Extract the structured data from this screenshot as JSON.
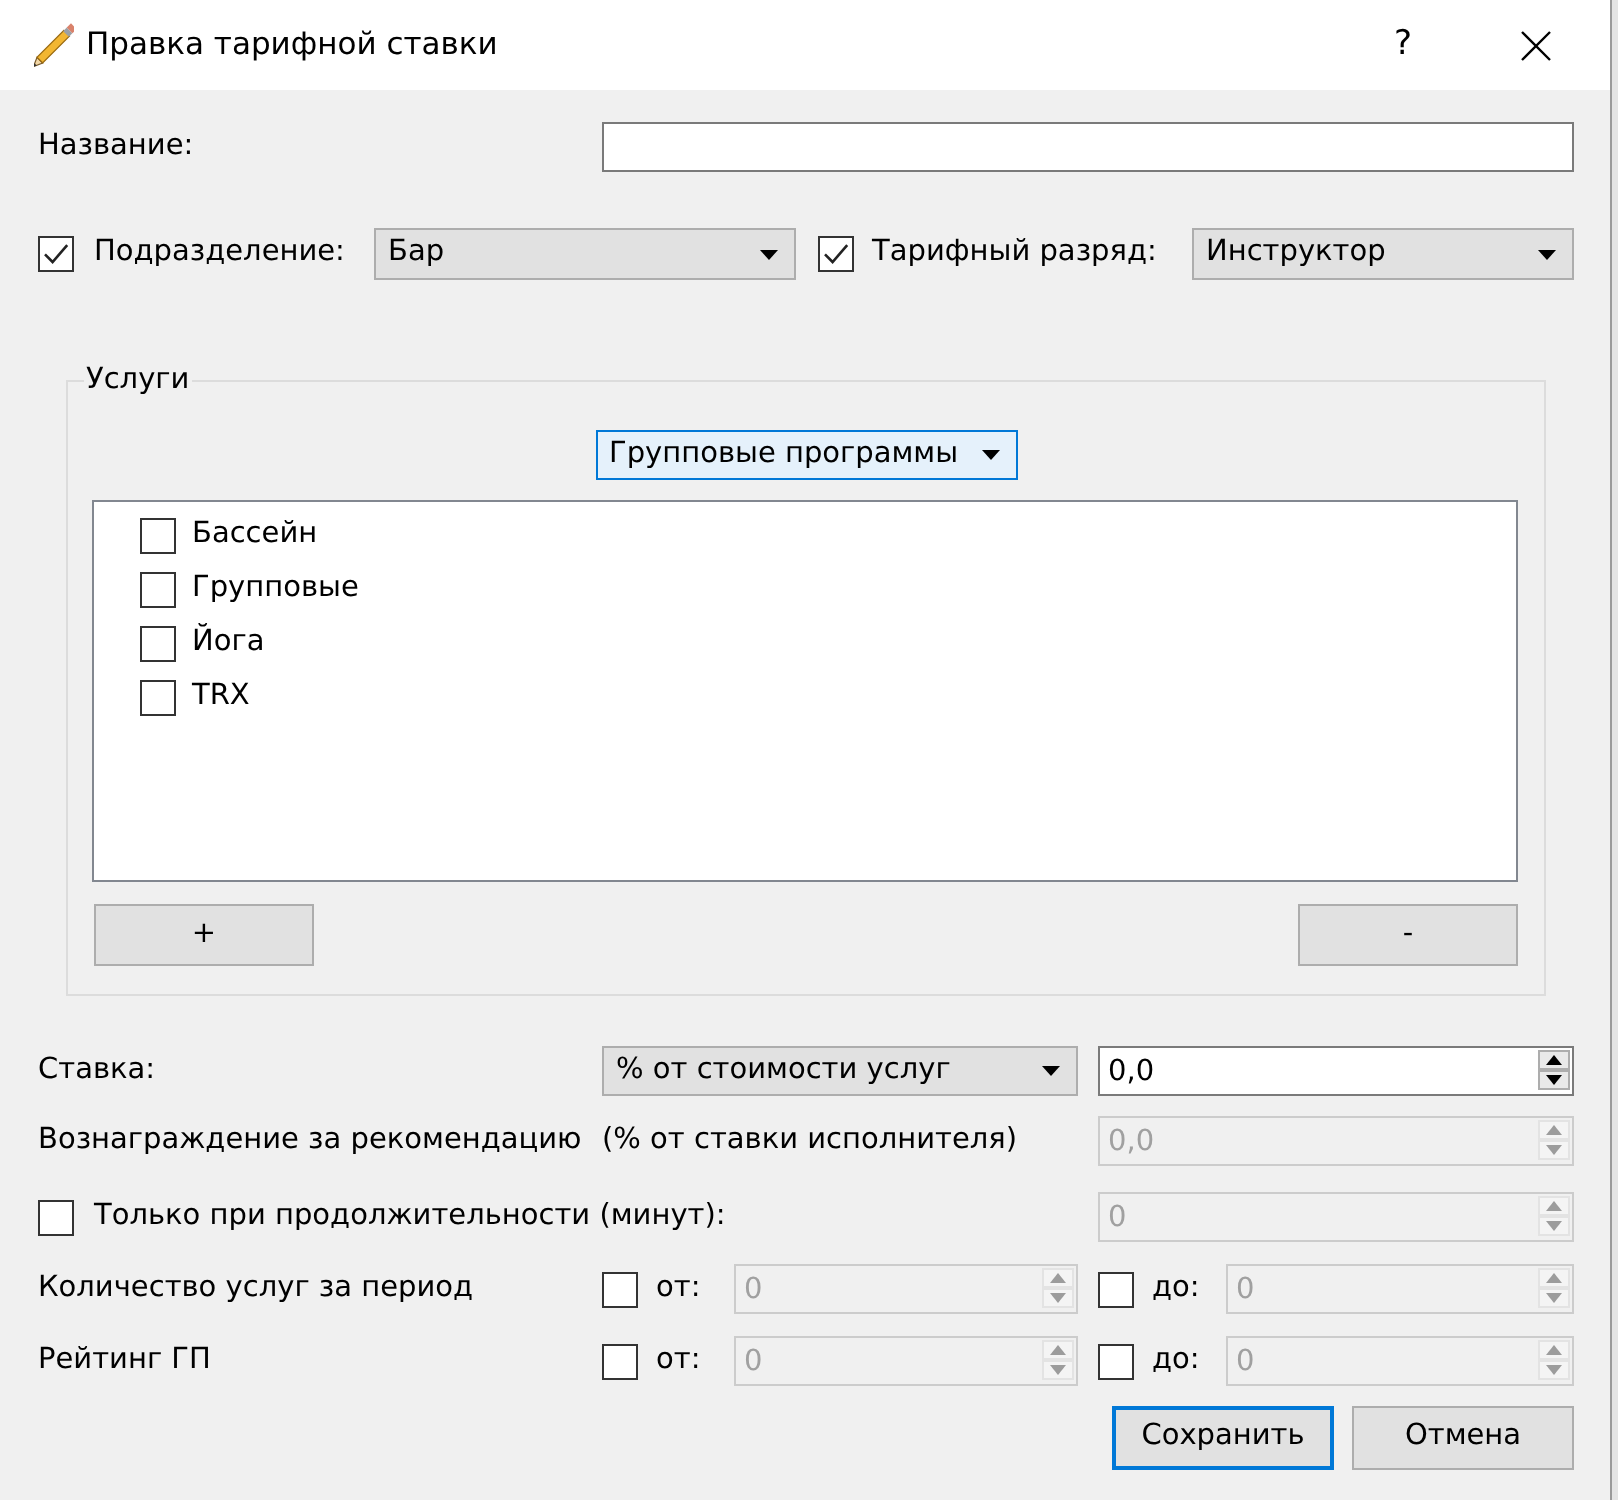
{
  "window": {
    "title": "Правка тарифной ставки",
    "help": "?"
  },
  "name_field": {
    "label": "Название:"
  },
  "filters": [
    {
      "checked": true,
      "label": "Подразделение:",
      "value": "Бар"
    },
    {
      "checked": true,
      "label": "Тарифный разряд:",
      "value": "Инструктор"
    }
  ],
  "services": {
    "title": "Услуги",
    "category": {
      "value": "Групповые программы",
      "focused": true
    },
    "items": [
      {
        "label": "Бассейн",
        "checked": false
      },
      {
        "label": "Групповые",
        "checked": false
      },
      {
        "label": "Йога",
        "checked": false
      },
      {
        "label": "TRX",
        "checked": false
      }
    ],
    "buttons": [
      "+",
      "-"
    ]
  },
  "rate": {
    "label": "Ставка:",
    "type": "% от стоимости услуг",
    "value": "0,0",
    "disabled": false
  },
  "referral": {
    "label": "Вознаграждение за рекомендацию",
    "note": "(% от ставки исполнителя)",
    "value": "0,0",
    "disabled": true
  },
  "duration": {
    "checked": false,
    "label": "Только при продолжительности (минут):",
    "value": "0",
    "disabled": true
  },
  "ranges": [
    {
      "label": "Количество услуг за период",
      "from": {
        "checked": false,
        "label": "от:",
        "value": "0",
        "disabled": true
      },
      "to": {
        "checked": false,
        "label": "до:",
        "value": "0",
        "disabled": true
      }
    },
    {
      "label": "Рейтинг ГП",
      "from": {
        "checked": false,
        "label": "от:",
        "value": "0",
        "disabled": true
      },
      "to": {
        "checked": false,
        "label": "до:",
        "value": "0",
        "disabled": true
      }
    }
  ],
  "buttons": [
    {
      "label": "Сохранить",
      "default": true
    },
    {
      "label": "Отмена",
      "default": false
    }
  ]
}
